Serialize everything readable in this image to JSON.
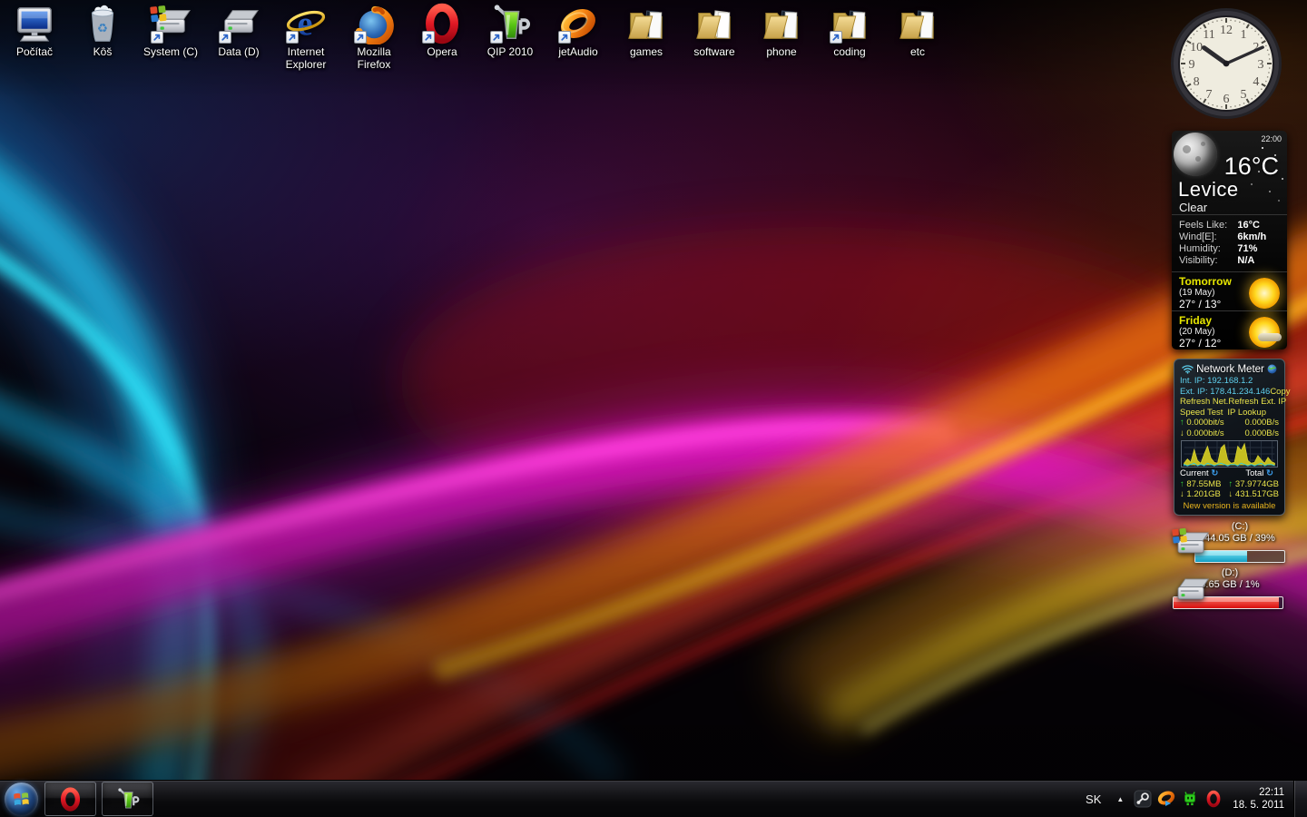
{
  "desktop": {
    "icons": [
      {
        "id": "pocitac",
        "label": "Počítač",
        "type": "computer",
        "shortcut": false
      },
      {
        "id": "kos",
        "label": "Kôš",
        "type": "trash",
        "shortcut": false
      },
      {
        "id": "system-c",
        "label": "System (C)",
        "type": "drive-win",
        "shortcut": true
      },
      {
        "id": "data-d",
        "label": "Data (D)",
        "type": "drive",
        "shortcut": true
      },
      {
        "id": "internet-explorer",
        "label": "Internet Explorer",
        "type": "ie",
        "shortcut": true
      },
      {
        "id": "mozilla-firefox",
        "label": "Mozilla Firefox",
        "type": "firefox",
        "shortcut": true
      },
      {
        "id": "opera",
        "label": "Opera",
        "type": "opera",
        "shortcut": true
      },
      {
        "id": "qip-2010",
        "label": "QIP 2010",
        "type": "qip",
        "shortcut": true
      },
      {
        "id": "jetaudio",
        "label": "jetAudio",
        "type": "jetaudio",
        "shortcut": true
      },
      {
        "id": "games",
        "label": "games",
        "type": "folder-dark",
        "shortcut": false
      },
      {
        "id": "software",
        "label": "software",
        "type": "folder-paper",
        "shortcut": false
      },
      {
        "id": "phone",
        "label": "phone",
        "type": "folder-dark",
        "shortcut": false
      },
      {
        "id": "coding",
        "label": "coding",
        "type": "folder-dark",
        "shortcut": true
      },
      {
        "id": "etc",
        "label": "etc",
        "type": "folder-dark",
        "shortcut": false
      }
    ]
  },
  "gadgets": {
    "clock": {
      "time": "22:11"
    },
    "weather": {
      "time": "22:00",
      "temperature": "16°C",
      "city": "Levice",
      "condition": "Clear",
      "details": [
        {
          "label": "Feels Like:",
          "value": "16°C"
        },
        {
          "label": "Wind[E]:",
          "value": "6km/h"
        },
        {
          "label": "Humidity:",
          "value": "71%"
        },
        {
          "label": "Visibility:",
          "value": "N/A"
        }
      ],
      "forecast": [
        {
          "day": "Tomorrow",
          "date": "(19 May)",
          "temps": "27° / 13°",
          "icon": "sunny"
        },
        {
          "day": "Friday",
          "date": "(20 May)",
          "temps": "27° / 12°",
          "icon": "partly-sunny"
        }
      ]
    },
    "network_meter": {
      "title": "Network Meter",
      "int_ip_label": "Int. IP:",
      "int_ip": "192.168.1.2",
      "ext_ip_label": "Ext. IP:",
      "ext_ip": "178.41.234.146",
      "copy_label": "Copy",
      "refresh_net": "Refresh Net.",
      "refresh_ext": "Refresh Ext. IP",
      "speed_test": "Speed Test",
      "ip_lookup": "IP Lookup",
      "up_arrow": "↑",
      "down_arrow": "↓",
      "up_speed": "0.000bit/s",
      "up_bytes": "0.000B/s",
      "down_speed": "0.000bit/s",
      "down_bytes": "0.000B/s",
      "current_label": "Current",
      "total_label": "Total",
      "refresh_glyph": "↻",
      "current_up": "87.55MB",
      "current_down": "1.201GB",
      "total_up": "37.9774GB",
      "total_down": "431.517GB",
      "notice": "New version is available",
      "graph_up": [
        2,
        7,
        3,
        18,
        5,
        2,
        13,
        22,
        8,
        3,
        2,
        20,
        24,
        6,
        2,
        3,
        22,
        17,
        25,
        5,
        2,
        3,
        11,
        6,
        2,
        9,
        4,
        2
      ],
      "graph_down": [
        1,
        0,
        1,
        2,
        0,
        1,
        0,
        2,
        1,
        0,
        1,
        2,
        1,
        0,
        1,
        1,
        0,
        2,
        1,
        0,
        1,
        0,
        1,
        2,
        0,
        1,
        1,
        0
      ]
    },
    "drives": {
      "c": {
        "name": "(C:)",
        "usage": "44.05 GB / 39%",
        "fill_percent": 58,
        "fill_color_top": "#7ae8f8",
        "fill_color_bottom": "#129ec4"
      },
      "d": {
        "name": "(D:)",
        "usage": "5.65 GB / 1%",
        "fill_percent": 97,
        "fill_color_top": "#ff7060",
        "fill_color_bottom": "#d80e0e"
      }
    }
  },
  "taskbar": {
    "apps": [
      {
        "id": "opera"
      },
      {
        "id": "qip"
      }
    ],
    "tray": {
      "language": "SK",
      "icons": [
        "steam",
        "jetaudio",
        "qip",
        "opera"
      ],
      "time": "22:11",
      "date": "18. 5. 2011"
    }
  },
  "theme": {
    "link_yellow": "#e8e24a",
    "ip_cyan": "#5fd0ee",
    "up_green": "#34c93a",
    "drive_c_accent": "#28b8d8",
    "drive_d_accent": "#e81818",
    "taskbar_bg": "#0d0d10"
  }
}
